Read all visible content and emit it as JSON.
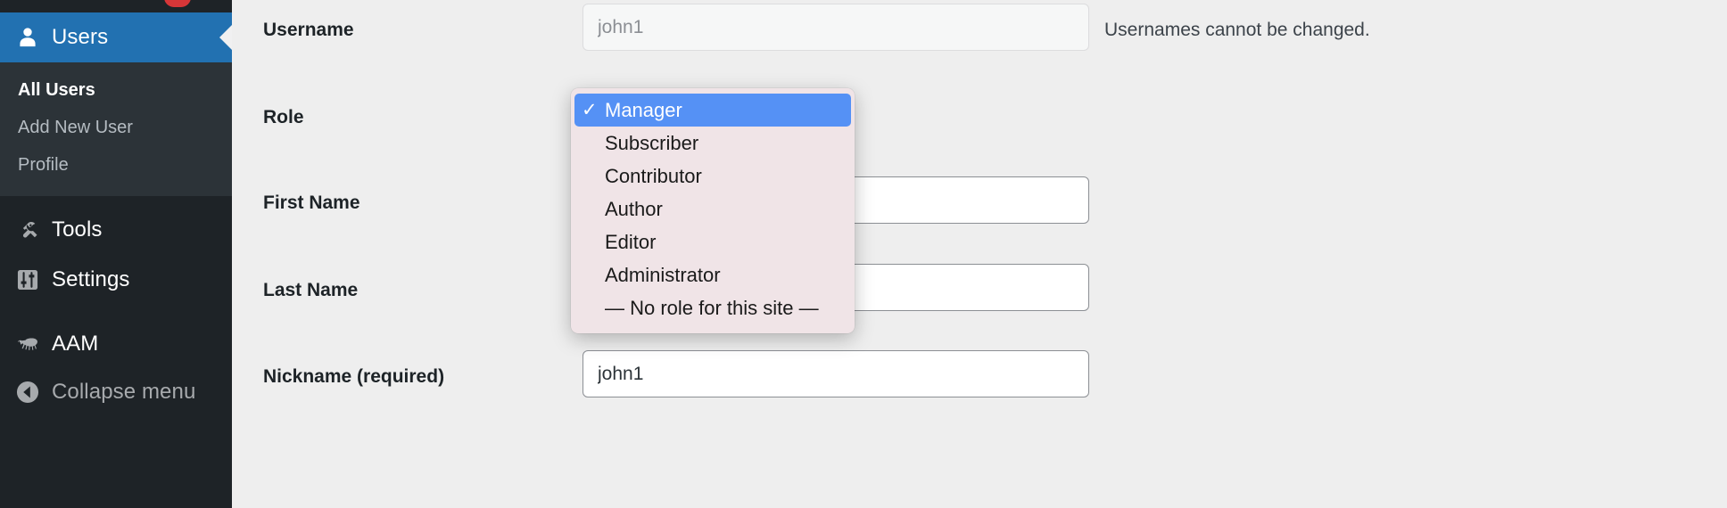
{
  "sidebar": {
    "notification_badge": true,
    "current_menu": {
      "label": "Users",
      "icon": "user-icon"
    },
    "submenu": [
      {
        "label": "All Users",
        "current": true
      },
      {
        "label": "Add New User",
        "current": false
      },
      {
        "label": "Profile",
        "current": false
      }
    ],
    "menu": [
      {
        "label": "Tools",
        "icon": "wrench-icon"
      },
      {
        "label": "Settings",
        "icon": "sliders-icon"
      },
      {
        "label": "AAM",
        "icon": "armadillo-icon"
      },
      {
        "label": "Collapse menu",
        "icon": "collapse-left-arrow-icon"
      }
    ]
  },
  "form": {
    "rows": [
      {
        "label": "Username",
        "value": "john1",
        "placeholder": "john1",
        "hint": "Usernames cannot be changed.",
        "disabled": true
      },
      {
        "label": "Role",
        "value": "Manager",
        "hint": ""
      },
      {
        "label": "First Name",
        "value": "",
        "placeholder": "",
        "hint": ""
      },
      {
        "label": "Last Name",
        "value": "",
        "placeholder": "",
        "hint": ""
      },
      {
        "label": "Nickname (required)",
        "value": "john1",
        "placeholder": "",
        "hint": ""
      }
    ]
  },
  "role_dropdown": {
    "open": true,
    "selected_index": 0,
    "check_glyph": "✓",
    "highlight_color": "#5591f5",
    "background_color": "#f0e4e7",
    "options": [
      {
        "label": "Manager"
      },
      {
        "label": "Subscriber"
      },
      {
        "label": "Contributor"
      },
      {
        "label": "Author"
      },
      {
        "label": "Editor"
      },
      {
        "label": "Administrator"
      },
      {
        "label": "— No role for this site —"
      }
    ]
  }
}
